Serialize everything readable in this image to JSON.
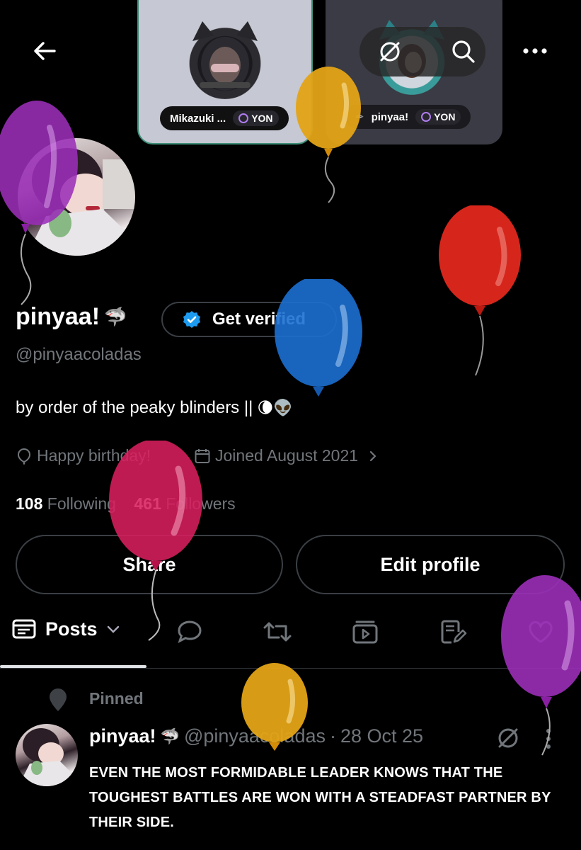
{
  "header": {
    "back_icon": "arrow-left-icon",
    "more_icon": "more-horizontal-icon",
    "search_icon": "search-icon",
    "hidden_icon": "slash-circle-icon"
  },
  "cards": [
    {
      "name": "Mikazuki ...",
      "badge": "YON"
    },
    {
      "name": "pinyaa!",
      "badge": "YON"
    }
  ],
  "profile": {
    "display_name": "pinyaa!",
    "name_emoji": "🦈",
    "verify_label": "Get verified",
    "handle": "@pinyaacoladas",
    "bio": "by order of the peaky blinders ||",
    "bio_emoji": "🌘👽",
    "birthday": "Happy birthday!",
    "joined": "Joined August 2021",
    "following_count": "108",
    "following_label": "Following",
    "followers_count": "461",
    "followers_label": "Followers"
  },
  "actions": {
    "share_label": "Share",
    "edit_label": "Edit profile"
  },
  "tabs": {
    "posts_label": "Posts"
  },
  "post": {
    "pinned_label": "Pinned",
    "author": "pinyaa!",
    "author_emoji": "🦈",
    "handle": "@pinyaacoladas",
    "separator": "·",
    "date": "28 Oct 25",
    "text": "EVEN THE MOST FORMIDABLE LEADER KNOWS THAT THE TOUGHEST BATTLES ARE WON WITH A STEADFAST PARTNER BY THEIR SIDE."
  },
  "colors": {
    "background": "#000000",
    "verify_blue": "#1d9bf0",
    "muted": "#71767b",
    "balloon_purple": "#9b2fb8",
    "balloon_yellow": "#e3a316",
    "balloon_red": "#d6261c",
    "balloon_blue": "#1c6fd0",
    "balloon_pink": "#d81f5f"
  }
}
